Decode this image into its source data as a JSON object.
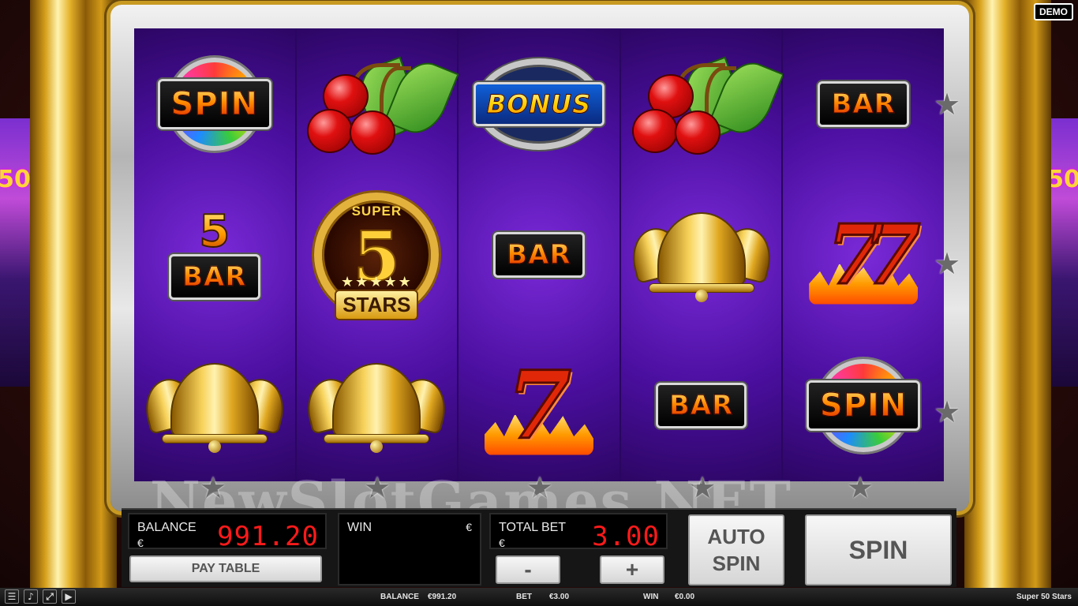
{
  "game": {
    "title": "Super 50 Stars",
    "demo_badge": "DEMO",
    "watermark": "NewSlotGames.NET"
  },
  "side_machines": {
    "left_text": "50",
    "right_text": "50"
  },
  "reels": [
    {
      "symbols": [
        {
          "type": "spin",
          "label": "SPIN"
        },
        {
          "type": "5bar",
          "digit": "5",
          "label": "BAR"
        },
        {
          "type": "bells"
        }
      ]
    },
    {
      "symbols": [
        {
          "type": "cherries"
        },
        {
          "type": "super5",
          "top": "SUPER",
          "digit": "5",
          "stars": "★★★★★",
          "label": "STARS"
        },
        {
          "type": "bells"
        }
      ]
    },
    {
      "symbols": [
        {
          "type": "bonus",
          "label": "BONUS"
        },
        {
          "type": "bar",
          "label": "BAR"
        },
        {
          "type": "seven",
          "digit": "7"
        }
      ]
    },
    {
      "symbols": [
        {
          "type": "cherries"
        },
        {
          "type": "bells"
        },
        {
          "type": "bar",
          "label": "BAR"
        }
      ]
    },
    {
      "symbols": [
        {
          "type": "bar",
          "label": "BAR"
        },
        {
          "type": "sevens",
          "digit": "77"
        },
        {
          "type": "spin",
          "label": "SPIN"
        }
      ]
    }
  ],
  "frame_stars": {
    "glyph": "★"
  },
  "panel": {
    "balance_label": "BALANCE",
    "balance_currency": "€",
    "balance_value": "991.20",
    "win_label": "WIN",
    "win_currency": "€",
    "win_value": "",
    "total_bet_label": "TOTAL BET",
    "total_bet_currency": "€",
    "total_bet_value": "3.00",
    "pay_table_label": "PAY TABLE",
    "minus_label": "-",
    "plus_label": "+",
    "auto_spin_label": "AUTO SPIN",
    "spin_label": "SPIN"
  },
  "bottom_bar": {
    "icons": [
      "menu-icon",
      "sound-icon",
      "fullscreen-icon",
      "video-icon"
    ],
    "balance_label": "BALANCE",
    "balance_value": "€991.20",
    "bet_label": "BET",
    "bet_value": "€3.00",
    "win_label": "WIN",
    "win_value": "€0.00",
    "game_name": "Super 50 Stars"
  },
  "colors": {
    "reel_bg": "#4b0fa0",
    "meter_digits": "#ff1a1a",
    "pillar_gold": "#d8a11b"
  }
}
